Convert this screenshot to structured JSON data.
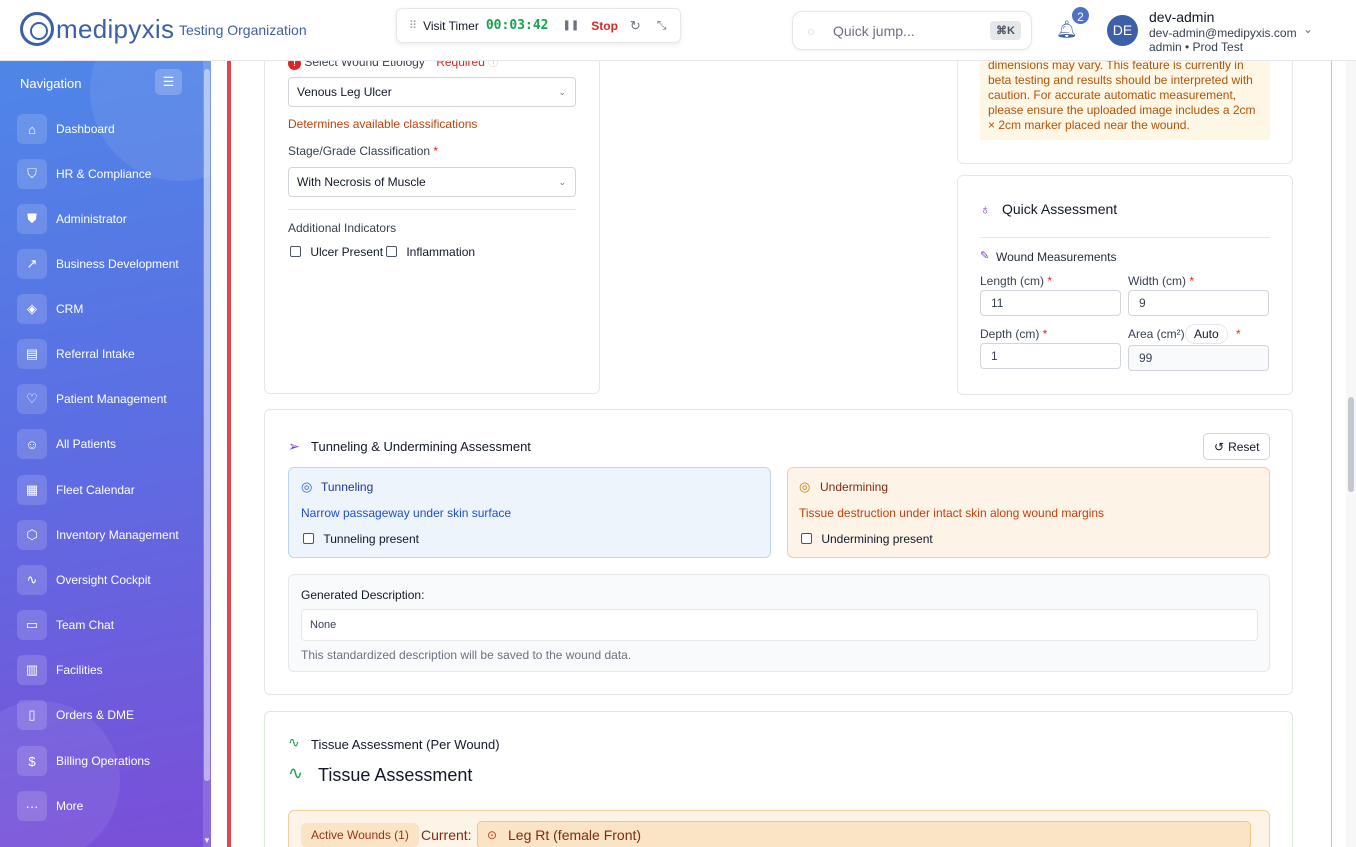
{
  "header": {
    "logo_text": "medipyxis",
    "org_name": "Testing Organization",
    "timer": {
      "label": "Visit Timer",
      "value": "00:03:42",
      "stop_label": "Stop"
    },
    "search": {
      "placeholder": "Quick jump...",
      "shortcut": "⌘K"
    },
    "notifications": {
      "count": "2"
    },
    "user": {
      "initials": "DE",
      "name": "dev-admin",
      "email": "dev-admin@medipyxis.com",
      "role": "admin • Prod Test"
    }
  },
  "sidebar": {
    "title": "Navigation",
    "items": [
      {
        "label": "Dashboard",
        "icon": "home-icon"
      },
      {
        "label": "HR & Compliance",
        "icon": "shield-icon"
      },
      {
        "label": "Administrator",
        "icon": "shield-check-icon"
      },
      {
        "label": "Business Development",
        "icon": "trending-up-icon"
      },
      {
        "label": "CRM",
        "icon": "handshake-icon"
      },
      {
        "label": "Referral Intake",
        "icon": "clipboard-icon"
      },
      {
        "label": "Patient Management",
        "icon": "heart-icon"
      },
      {
        "label": "All Patients",
        "icon": "users-icon"
      },
      {
        "label": "Fleet Calendar",
        "icon": "calendar-icon"
      },
      {
        "label": "Inventory Management",
        "icon": "package-icon"
      },
      {
        "label": "Oversight Cockpit",
        "icon": "activity-icon"
      },
      {
        "label": "Team Chat",
        "icon": "chat-icon"
      },
      {
        "label": "Facilities",
        "icon": "building-icon"
      },
      {
        "label": "Orders & DME",
        "icon": "document-icon"
      },
      {
        "label": "Billing Operations",
        "icon": "dollar-icon"
      },
      {
        "label": "More",
        "icon": "more-icon"
      }
    ]
  },
  "etiology": {
    "label": "Select Wound Etiology",
    "required_label": "Required",
    "value": "Venous Leg Ulcer",
    "hint": "Determines available classifications",
    "stage_label": "Stage/Grade Classification",
    "stage_value": "With Necrosis of Muscle",
    "indicators_label": "Additional Indicators",
    "indicators": [
      "Ulcer Present",
      "Inflammation"
    ]
  },
  "beta_notice": "dimensions may vary. This feature is currently in beta testing and results should be interpreted with caution. For accurate automatic measurement, please ensure the uploaded image includes a 2cm × 2cm marker placed near the wound.",
  "quick_assessment": {
    "title": "Quick Assessment",
    "measurements_title": "Wound Measurements",
    "length_label": "Length (cm)",
    "length_value": "11",
    "width_label": "Width (cm)",
    "width_value": "9",
    "depth_label": "Depth (cm)",
    "depth_value": "1",
    "area_label": "Area (cm²)",
    "area_auto": "Auto",
    "area_value": "99"
  },
  "tunneling": {
    "title": "Tunneling & Undermining Assessment",
    "reset_label": "Reset",
    "tunneling_title": "Tunneling",
    "tunneling_desc": "Narrow passageway under skin surface",
    "tunneling_check": "Tunneling present",
    "undermining_title": "Undermining",
    "undermining_desc": "Tissue destruction under intact skin along wound margins",
    "undermining_check": "Undermining present",
    "generated_label": "Generated Description:",
    "generated_value": "None",
    "generated_hint": "This standardized description will be saved to the wound data."
  },
  "tissue": {
    "section_title": "Tissue Assessment (Per Wound)",
    "heading": "Tissue Assessment",
    "active_wounds": "Active Wounds (1)",
    "current_label": "Current:",
    "current_value": "Leg Rt (female Front)"
  },
  "colors": {
    "brand": "#3b5fa8",
    "timer_green": "#16a34a",
    "danger": "#dc2626",
    "tunneling_bg": "#eef4fc",
    "undermining_bg": "#fdf3e7"
  }
}
